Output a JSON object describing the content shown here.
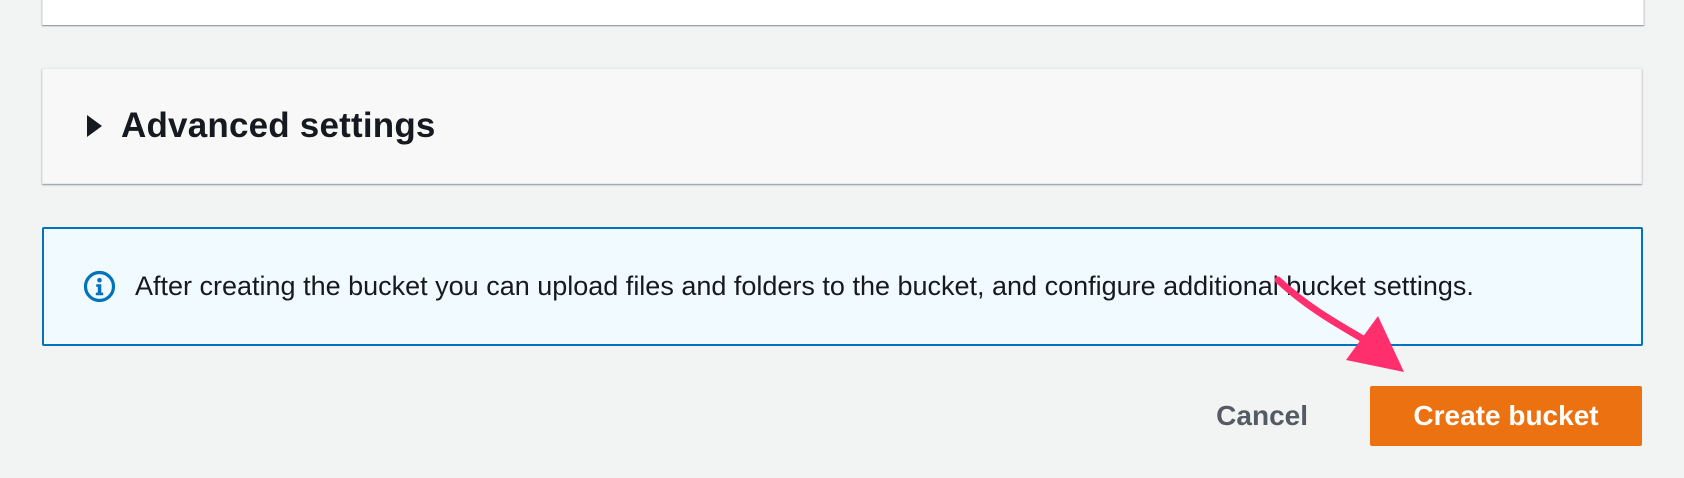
{
  "advanced_settings": {
    "title": "Advanced settings",
    "expanded": false
  },
  "info_alert": {
    "message": "After creating the bucket you can upload files and folders to the bucket, and configure additional bucket settings.",
    "icon": "info-icon"
  },
  "actions": {
    "cancel_label": "Cancel",
    "create_label": "Create bucket"
  },
  "colors": {
    "primary_button": "#ec7211",
    "info_border": "#0073bb",
    "info_background": "#f1faff",
    "annotation_arrow": "#ff2f6e"
  }
}
